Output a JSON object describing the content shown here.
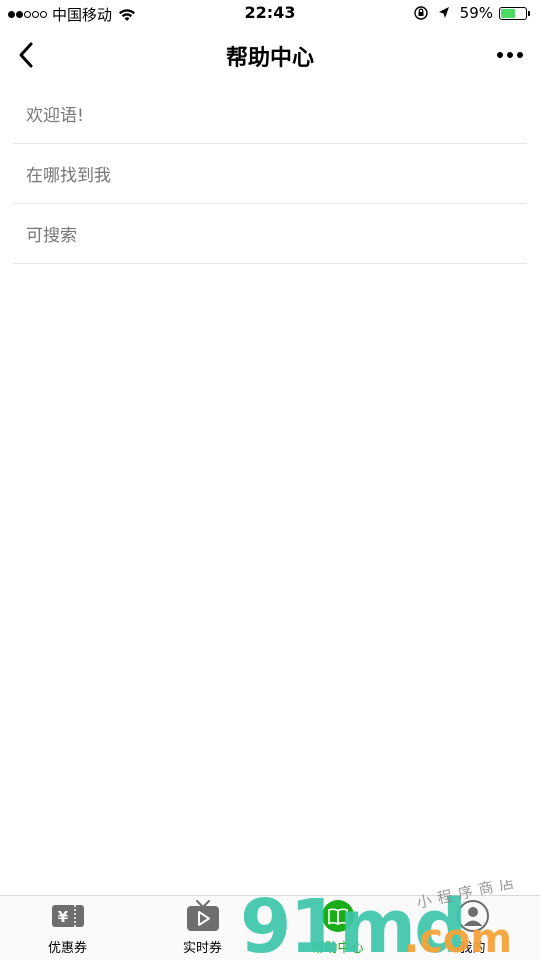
{
  "status_bar": {
    "carrier": "中国移动",
    "time": "22:43",
    "battery_percent": "59%",
    "battery_level": 0.59,
    "signal_strength": 2
  },
  "nav": {
    "title": "帮助中心",
    "back_icon": "chevron-left-icon",
    "more_icon": "more-dots-icon"
  },
  "list": {
    "items": [
      {
        "label": "欢迎语!"
      },
      {
        "label": "在哪找到我"
      },
      {
        "label": "可搜索"
      }
    ]
  },
  "tab_bar": {
    "tabs": [
      {
        "label": "优惠券",
        "icon": "coupon-icon"
      },
      {
        "label": "实时券",
        "icon": "tv-play-icon"
      },
      {
        "label": "帮助中心",
        "icon": "book-icon",
        "active": true
      },
      {
        "label": "我的",
        "icon": "user-icon"
      }
    ]
  },
  "watermark": {
    "logo_text": "91md",
    "logo_suffix": ".com",
    "tagline": "小程序商店"
  },
  "colors": {
    "active_tab": "#1aad19",
    "list_text": "#777777",
    "divider": "#e6e6e6",
    "battery": "#4cd964"
  }
}
